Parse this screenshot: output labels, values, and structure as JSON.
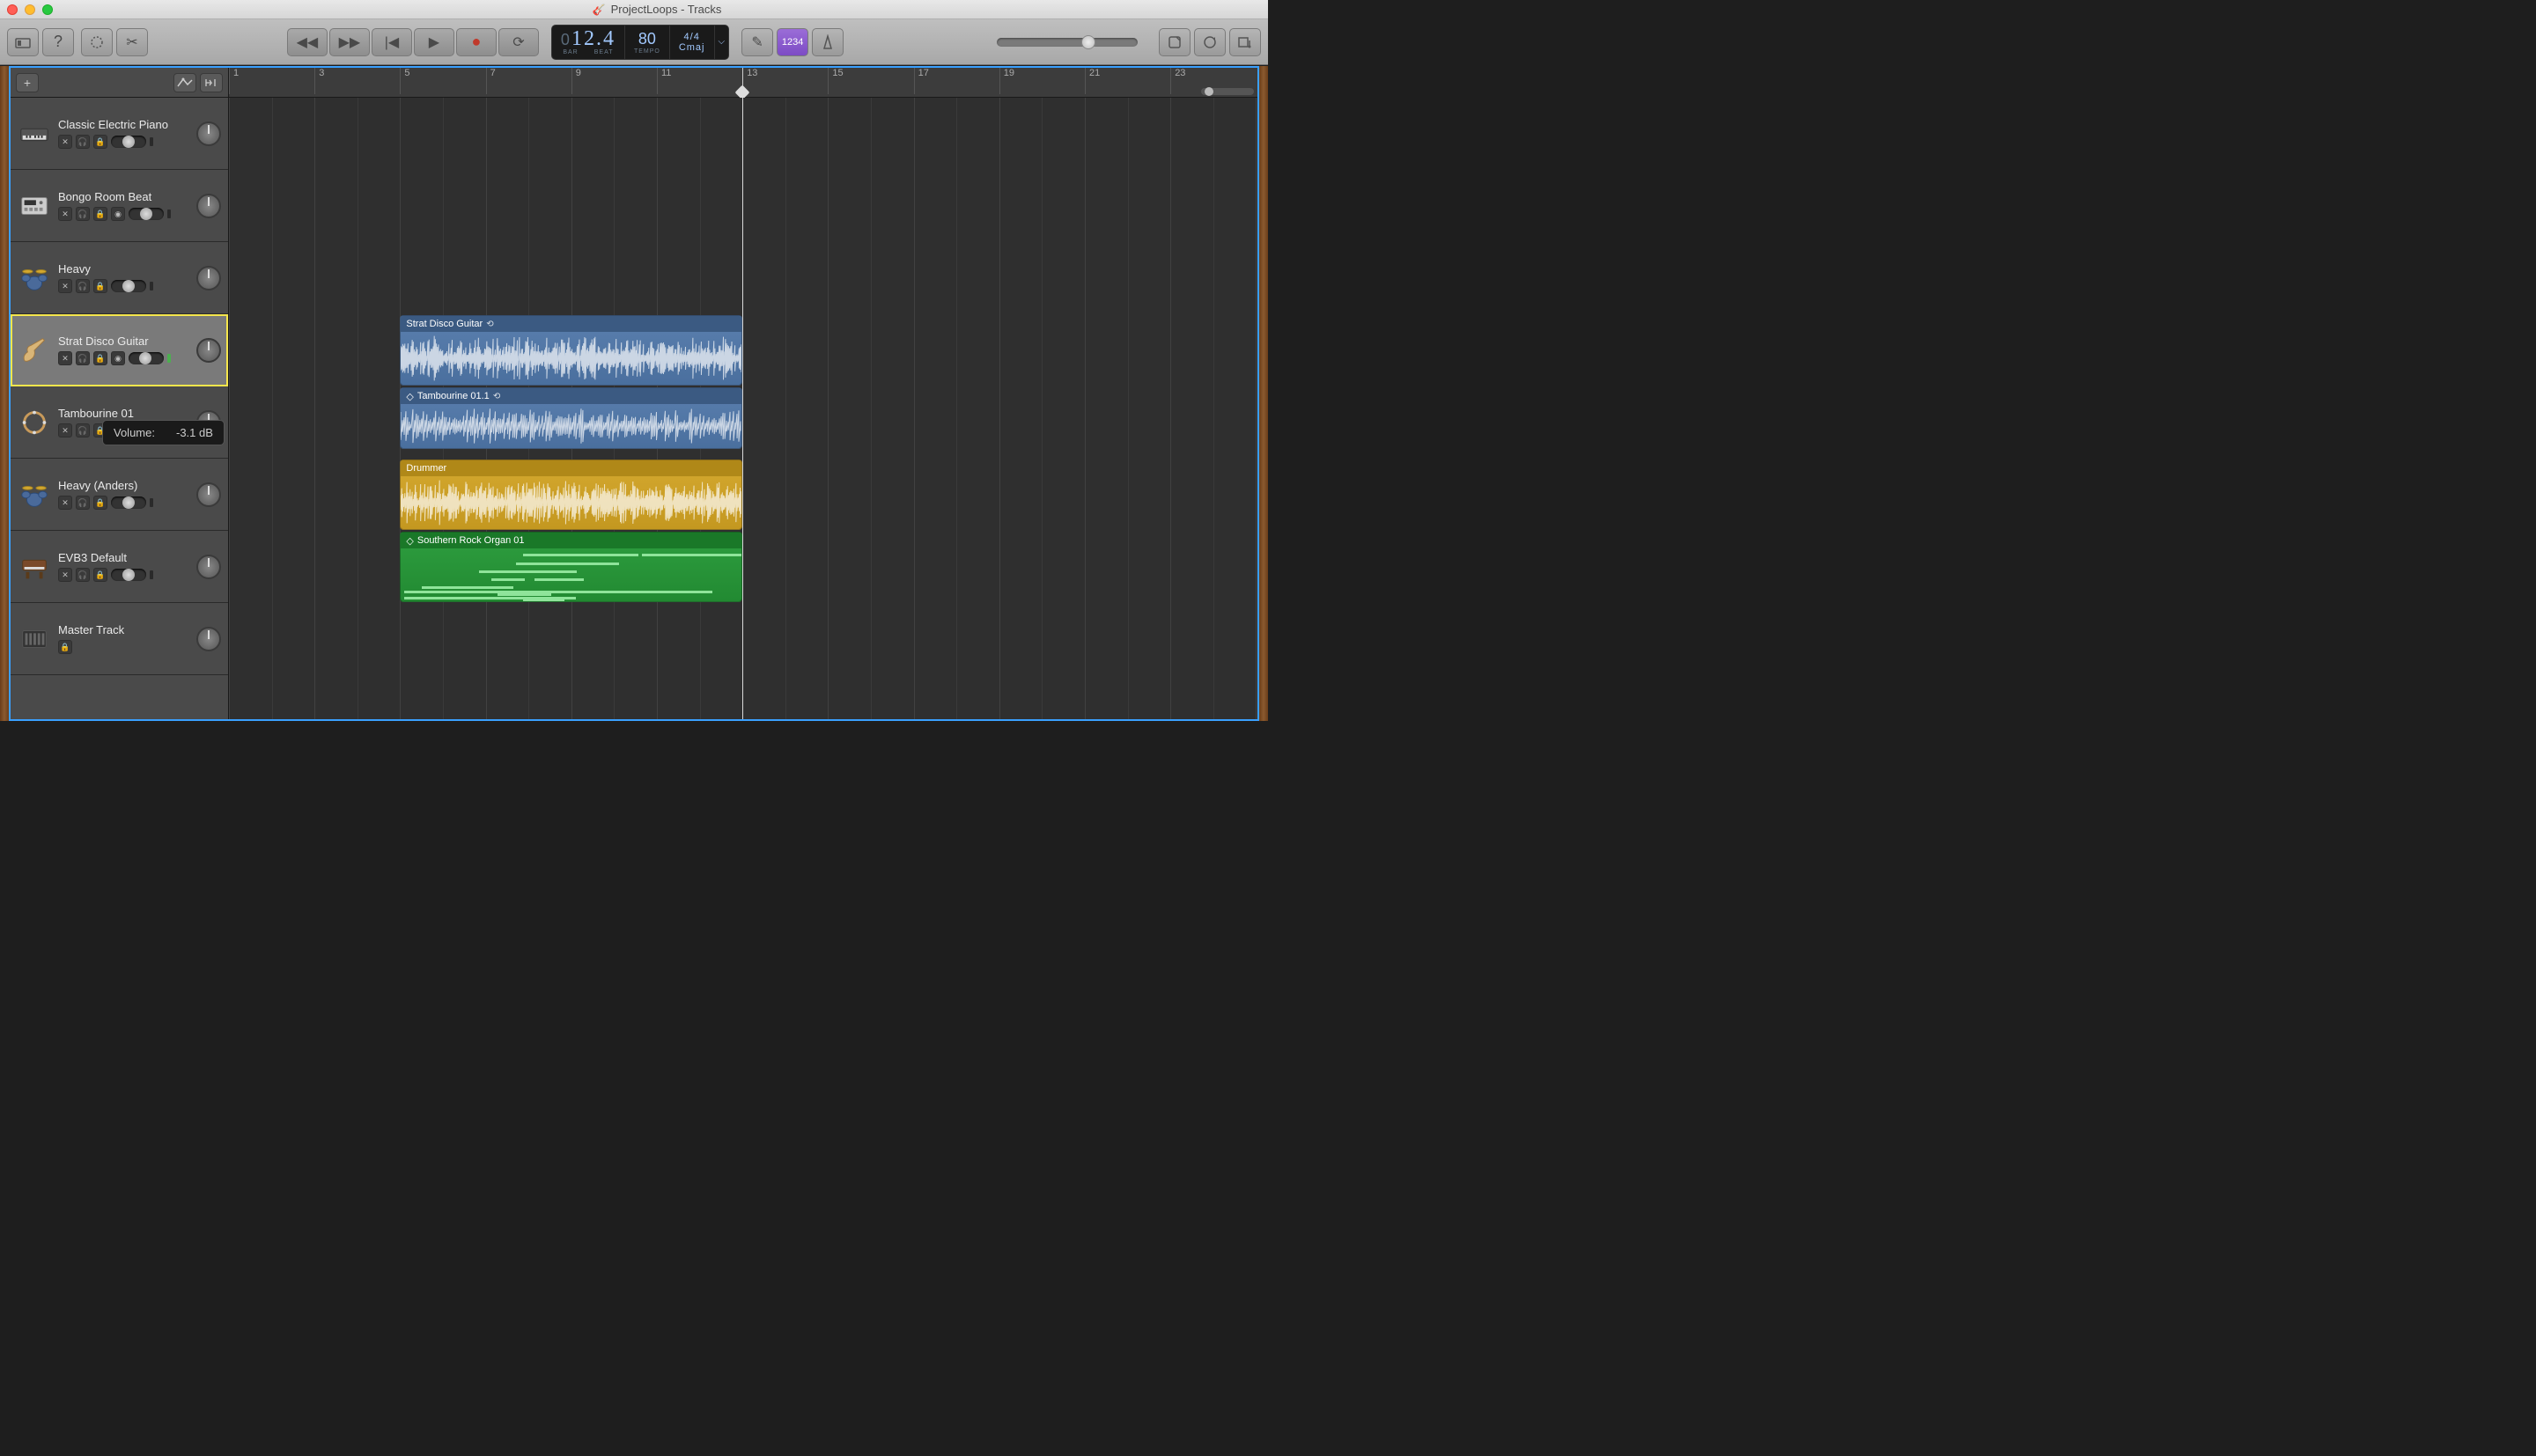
{
  "window": {
    "title": "ProjectLoops - Tracks"
  },
  "lcd": {
    "position_pre": "0",
    "position": "12.4",
    "bar_label": "BAR",
    "beat_label": "BEAT",
    "tempo": "80",
    "tempo_label": "TEMPO",
    "timesig": "4/4",
    "key": "Cmaj"
  },
  "toolbar": {
    "count_label": "1234"
  },
  "tooltip": {
    "label": "Volume:",
    "value": "-3.1 dB"
  },
  "ruler": {
    "ticks": [
      "1",
      "3",
      "5",
      "7",
      "9",
      "11",
      "13",
      "15",
      "17",
      "19",
      "21",
      "23"
    ]
  },
  "tracks": [
    {
      "name": "Classic Electric Piano",
      "icon": "piano",
      "selected": false,
      "hasInput": false,
      "vol": 0.5
    },
    {
      "name": "Bongo Room Beat",
      "icon": "drummachine",
      "selected": false,
      "hasInput": true,
      "vol": 0.5
    },
    {
      "name": "Heavy",
      "icon": "drumkit",
      "selected": false,
      "hasInput": false,
      "vol": 0.5
    },
    {
      "name": "Strat Disco Guitar",
      "icon": "guitar",
      "selected": true,
      "hasInput": true,
      "vol": 0.46
    },
    {
      "name": "Tambourine 01",
      "icon": "tambourine",
      "selected": false,
      "hasInput": true,
      "vol": 0.5,
      "muted": true
    },
    {
      "name": "Heavy (Anders)",
      "icon": "drumkit",
      "selected": false,
      "hasInput": false,
      "vol": 0.5
    },
    {
      "name": "EVB3 Default",
      "icon": "organ",
      "selected": false,
      "hasInput": false,
      "vol": 0.5
    },
    {
      "name": "Master Track",
      "icon": "master",
      "selected": false,
      "hasInput": false,
      "vol": 0.5,
      "master": true
    }
  ],
  "regions": [
    {
      "track": 3,
      "name": "Strat Disco Guitar",
      "color": "blue",
      "loop": true,
      "wave": true,
      "start": 5,
      "end": 13
    },
    {
      "track": 4,
      "name": "Tambourine 01.1",
      "color": "blue",
      "loop": true,
      "wave": true,
      "diamond": true,
      "start": 5,
      "end": 13,
      "short": true
    },
    {
      "track": 5,
      "name": "Drummer",
      "color": "yellow",
      "loop": false,
      "wave": true,
      "start": 5,
      "end": 13
    },
    {
      "track": 6,
      "name": "Southern Rock Organ 01",
      "color": "green",
      "loop": false,
      "midi": true,
      "diamond": true,
      "start": 5,
      "end": 13
    }
  ],
  "playhead_bar": 13
}
